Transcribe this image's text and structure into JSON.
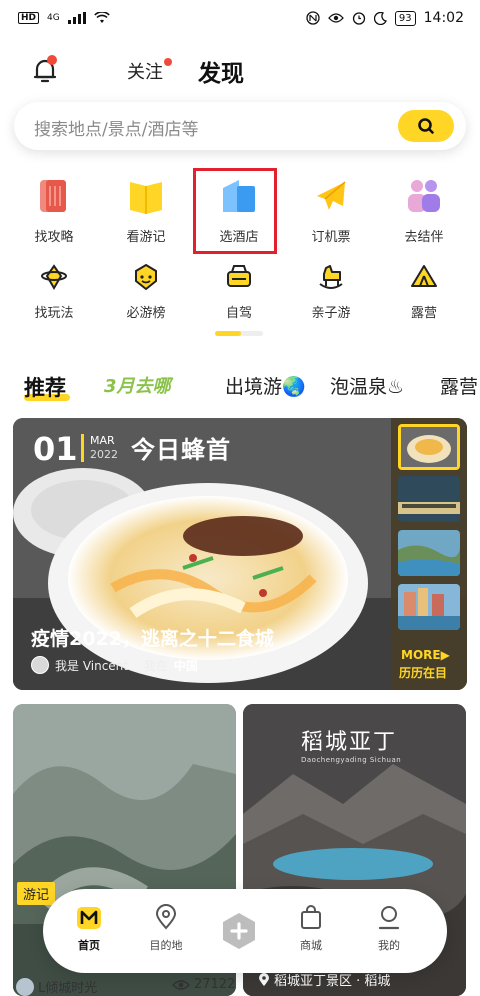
{
  "status_bar": {
    "hd": "HD",
    "network": "4G",
    "battery": "93",
    "time": "14:02"
  },
  "header": {
    "tab_follow": "关注",
    "tab_discover": "发现"
  },
  "search": {
    "placeholder": "搜索地点/景点/酒店等"
  },
  "quick_grid": {
    "row1": [
      "找攻略",
      "看游记",
      "选酒店",
      "订机票",
      "去结伴"
    ],
    "row2": [
      "找玩法",
      "必游榜",
      "自驾",
      "亲子游",
      "露营"
    ]
  },
  "category_tabs": [
    "推荐",
    "3月去哪",
    "出境游🌏",
    "泡温泉♨",
    "露营"
  ],
  "hero": {
    "day": "01",
    "month": "MAR",
    "year": "2022",
    "column": "今日蜂首",
    "title": "疫情2022，逃离之十二食城",
    "author": "我是 Vincent",
    "separator": "·",
    "location_prefix": "我在",
    "location": "中国",
    "more": "MORE▶",
    "more_sub": "历历在目"
  },
  "cards": {
    "left": {
      "tag": "游记",
      "author": "L倾城时光",
      "views": "27122"
    },
    "right": {
      "title": "稻城亚丁",
      "subtitle": "Daochengyading Sichuan",
      "location": "稻城亚丁景区 · 稻城"
    }
  },
  "bottom_nav": {
    "home": "首页",
    "destination": "目的地",
    "mall": "商城",
    "mine": "我的"
  },
  "colors": {
    "accent": "#ffd626",
    "badge_red": "#f04a3a",
    "highlight_red": "#e3202e"
  }
}
